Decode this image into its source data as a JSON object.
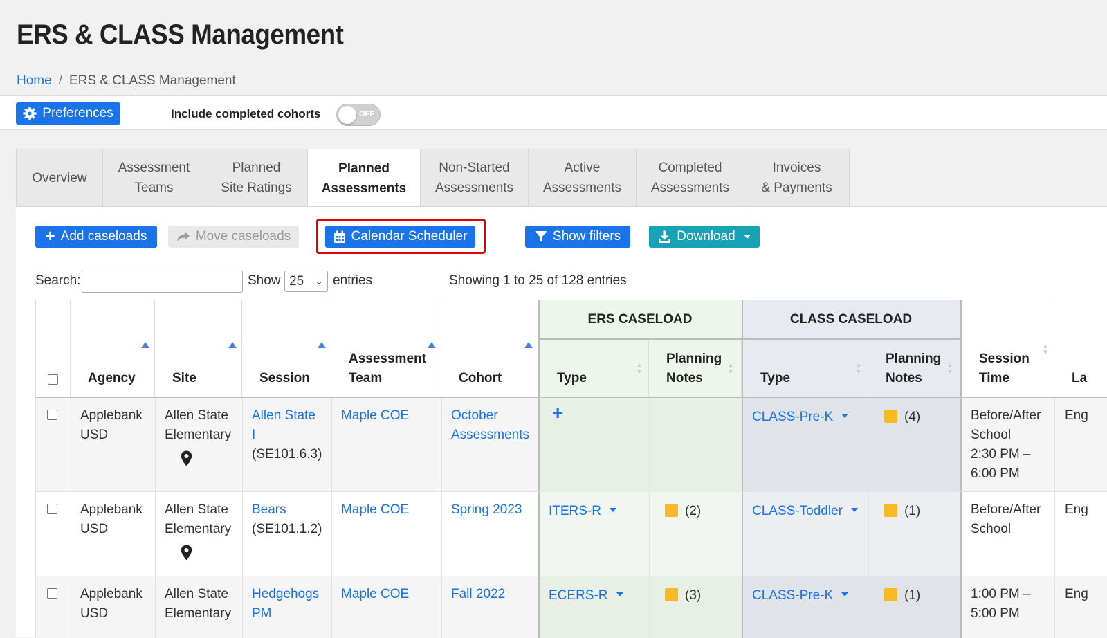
{
  "page_title": "ERS & CLASS Management",
  "breadcrumb": {
    "home": "Home",
    "separator": "/",
    "current": "ERS & CLASS Management"
  },
  "prefbar": {
    "preferences_label": "Preferences",
    "include_completed_label": "Include completed cohorts",
    "toggle_text": "OFF"
  },
  "tabs": [
    {
      "line1": "Overview",
      "line2": ""
    },
    {
      "line1": "Assessment",
      "line2": "Teams"
    },
    {
      "line1": "Planned",
      "line2": "Site Ratings"
    },
    {
      "line1": "Planned",
      "line2": "Assessments"
    },
    {
      "line1": "Non-Started",
      "line2": "Assessments"
    },
    {
      "line1": "Active",
      "line2": "Assessments"
    },
    {
      "line1": "Completed",
      "line2": "Assessments"
    },
    {
      "line1": "Invoices",
      "line2": "& Payments"
    }
  ],
  "toolbar": {
    "add_caseloads": "Add caseloads",
    "move_caseloads": "Move caseloads",
    "calendar_scheduler": "Calendar Scheduler",
    "show_filters": "Show filters",
    "download": "Download"
  },
  "table_controls": {
    "search_label": "Search:",
    "search_value": "",
    "show_label": "Show",
    "page_size": "25",
    "entries_label": "entries",
    "showing_text": "Showing 1 to 25 of 128 entries"
  },
  "table": {
    "group_headers": {
      "ers": "ERS CASELOAD",
      "class": "CLASS CASELOAD"
    },
    "columns": {
      "agency": "Agency",
      "site": "Site",
      "session": "Session",
      "team_1": "Assessment",
      "team_2": "Team",
      "cohort": "Cohort",
      "ers_type": "Type",
      "ers_notes_1": "Planning",
      "ers_notes_2": "Notes",
      "class_type": "Type",
      "class_notes_1": "Planning",
      "class_notes_2": "Notes",
      "session_time_1": "Session",
      "session_time_2": "Time",
      "language_partial": "La"
    },
    "rows": [
      {
        "agency": [
          "Applebank",
          "USD"
        ],
        "site": [
          "Allen State",
          "Elementary"
        ],
        "session": [
          "Allen State",
          "I"
        ],
        "session_code": "(SE101.6.3)",
        "team": "Maple COE",
        "cohort": [
          "October",
          "Assessments"
        ],
        "ers_type": "",
        "ers_notes": "",
        "class_type": "CLASS-Pre-K",
        "class_notes": "(4)",
        "session_time": [
          "Before/After",
          "School",
          "2:30 PM –",
          "6:00 PM"
        ],
        "language": "Eng"
      },
      {
        "agency": [
          "Applebank",
          "USD"
        ],
        "site": [
          "Allen State",
          "Elementary"
        ],
        "session": [
          "Bears"
        ],
        "session_code": "(SE101.1.2)",
        "team": "Maple COE",
        "cohort": [
          "Spring 2023"
        ],
        "ers_type": "ITERS-R",
        "ers_notes": "(2)",
        "class_type": "CLASS-Toddler",
        "class_notes": "(1)",
        "session_time": [
          "Before/After",
          "School"
        ],
        "language": "Eng"
      },
      {
        "agency": [
          "Applebank",
          "USD"
        ],
        "site": [
          "Allen State",
          "Elementary"
        ],
        "session": [
          "Hedgehogs",
          "PM"
        ],
        "session_code": "",
        "team": "Maple COE",
        "cohort": [
          "Fall 2022"
        ],
        "ers_type": "ECERS-R",
        "ers_notes": "(3)",
        "class_type": "CLASS-Pre-K",
        "class_notes": "(1)",
        "session_time": [
          "1:00 PM –",
          "5:00 PM"
        ],
        "language": "Eng"
      }
    ]
  },
  "colors": {
    "primary": "#1a73e8",
    "info": "#17a2b8",
    "highlight_outline": "#e00000",
    "ers_bg": "#edf5ec",
    "class_bg": "#e7eaee",
    "note_icon": "#f7b924"
  }
}
